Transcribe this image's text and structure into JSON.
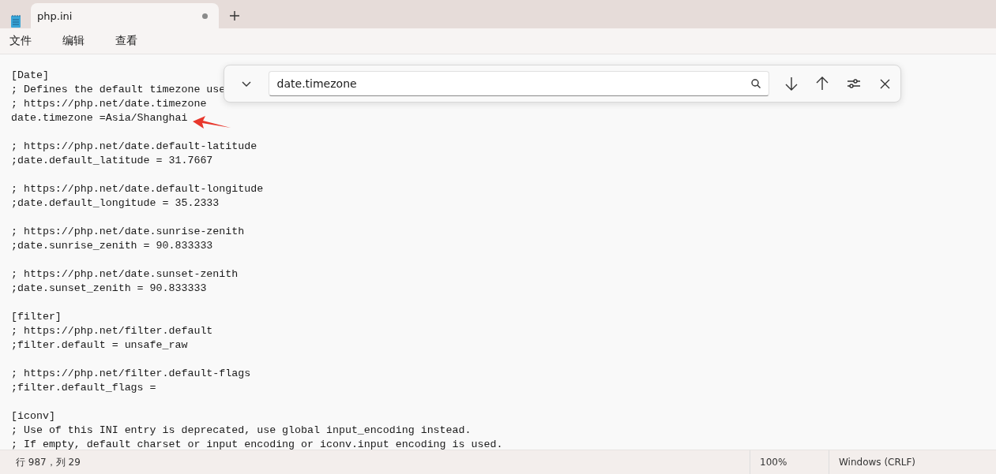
{
  "tab": {
    "title": "php.ini",
    "modified": true
  },
  "menu": [
    "文件",
    "编辑",
    "查看"
  ],
  "find": {
    "value": "date.timezone"
  },
  "editor": {
    "blocks": [
      [
        "[Date]",
        "; Defines the default timezone use",
        "; https://php.net/date.timezone",
        "date.timezone =Asia/Shanghai"
      ],
      [
        "; https://php.net/date.default-latitude",
        ";date.default_latitude = 31.7667"
      ],
      [
        "; https://php.net/date.default-longitude",
        ";date.default_longitude = 35.2333"
      ],
      [
        "; https://php.net/date.sunrise-zenith",
        ";date.sunrise_zenith = 90.833333"
      ],
      [
        "; https://php.net/date.sunset-zenith",
        ";date.sunset_zenith = 90.833333"
      ],
      [
        "[filter]",
        "; https://php.net/filter.default",
        ";filter.default = unsafe_raw"
      ],
      [
        "; https://php.net/filter.default-flags",
        ";filter.default_flags ="
      ],
      [
        "[iconv]",
        "; Use of this INI entry is deprecated, use global input_encoding instead.",
        "; If empty, default charset or input encoding or iconv.input encoding is used."
      ]
    ]
  },
  "status": {
    "position": "行 987，列 29",
    "zoom": "100%",
    "line_ending": "Windows (CRLF)"
  }
}
